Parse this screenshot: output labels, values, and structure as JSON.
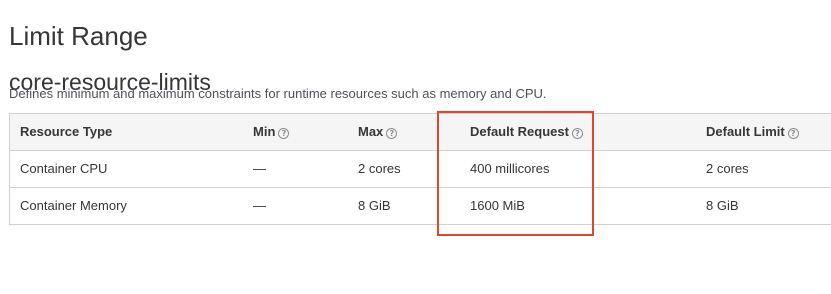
{
  "page": {
    "title": "Limit Range"
  },
  "section": {
    "title": "core-resource-limits",
    "description": "Defines minimum and maximum constraints for runtime resources such as memory and CPU."
  },
  "table": {
    "headers": {
      "resource_type": "Resource Type",
      "min": "Min",
      "max": "Max",
      "default_request": "Default Request",
      "default_limit": "Default Limit"
    },
    "rows": [
      {
        "resource_type": "Container CPU",
        "min": "—",
        "max": "2 cores",
        "default_request": "400 millicores",
        "default_limit": "2 cores"
      },
      {
        "resource_type": "Container Memory",
        "min": "—",
        "max": "8 GiB",
        "default_request": "1600 MiB",
        "default_limit": "8 GiB"
      }
    ]
  },
  "icons": {
    "help": "question-circle-icon"
  },
  "colors": {
    "highlight": "#e0462c",
    "header_bg": "#f5f5f5",
    "border": "#d1d1d1"
  }
}
